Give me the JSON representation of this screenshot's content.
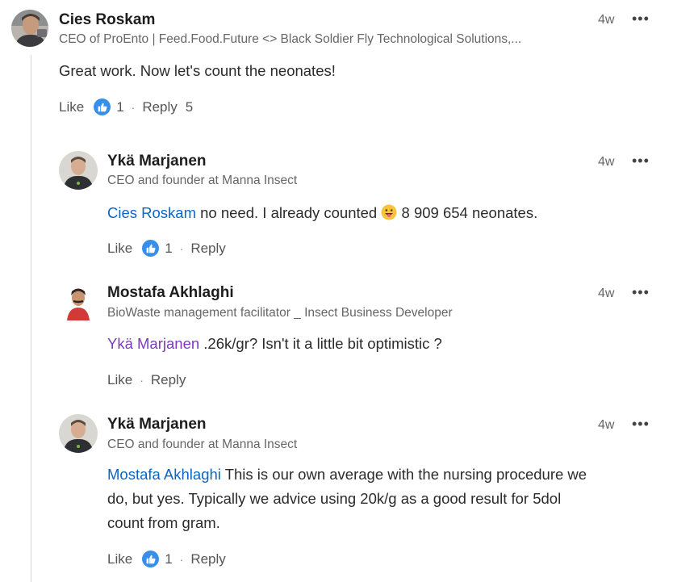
{
  "comments": [
    {
      "author": "Cies Roskam",
      "headline": "CEO of ProEnto | Feed.Food.Future <> Black Soldier Fly Technological Solutions,...",
      "time": "4w",
      "text": "Great work. Now let's count the neonates!",
      "like_label": "Like",
      "like_count": "1",
      "reply_label": "Reply",
      "reply_count": "5"
    },
    {
      "author": "Ykä Marjanen",
      "headline": "CEO and founder at Manna Insect",
      "time": "4w",
      "mention": "Cies Roskam",
      "text_before_emoji": " no need. I already counted ",
      "text_after_emoji": " 8 909 654 neonates.",
      "emoji": "grinning-tongue-emoji",
      "like_label": "Like",
      "like_count": "1",
      "reply_label": "Reply"
    },
    {
      "author": "Mostafa Akhlaghi",
      "headline": "BioWaste management facilitator _ Insect Business Developer",
      "time": "4w",
      "mention": "Ykä Marjanen",
      "text": " .26k/gr? Isn't it a little bit optimistic ?",
      "like_label": "Like",
      "reply_label": "Reply"
    },
    {
      "author": "Ykä Marjanen",
      "headline": "CEO and founder at Manna Insect",
      "time": "4w",
      "mention": "Mostafa Akhlaghi",
      "text_line1": " This is our own average with the nursing procedure we",
      "text_line2": "do, but yes. Typically we advice using 20k/g as a good result for 5dol",
      "text_line3": "count from gram.",
      "like_label": "Like",
      "like_count": "1",
      "reply_label": "Reply"
    }
  ],
  "more_icon": "•••",
  "separator": "·",
  "colors": {
    "mention_blue": "#0a66c2",
    "mention_purple": "#7e3ab8",
    "like_badge": "#378fe9"
  }
}
